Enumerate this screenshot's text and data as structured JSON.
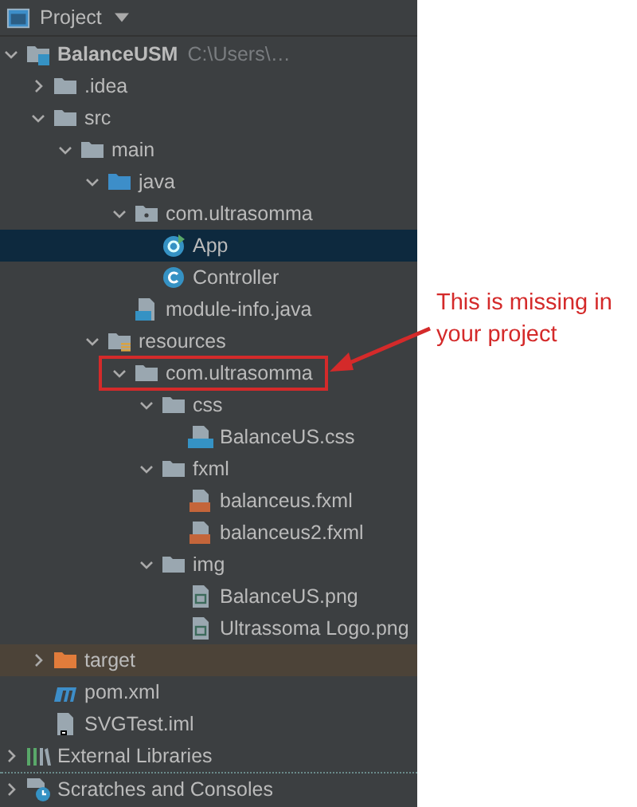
{
  "panel": {
    "title": "Project"
  },
  "tree": [
    {
      "label": "BalanceUSM",
      "path": "C:\\Users\\…",
      "kind": "module",
      "expanded": true,
      "selected": false,
      "children": [
        {
          "label": ".idea",
          "kind": "folder",
          "expanded": false,
          "selected": false
        },
        {
          "label": "src",
          "kind": "folder",
          "expanded": true,
          "selected": false,
          "children": [
            {
              "label": "main",
              "kind": "folder",
              "expanded": true,
              "selected": false,
              "children": [
                {
                  "label": "java",
                  "kind": "source-folder",
                  "expanded": true,
                  "selected": false,
                  "children": [
                    {
                      "label": "com.ultrasomma",
                      "kind": "package",
                      "expanded": true,
                      "selected": false,
                      "children": [
                        {
                          "label": "App",
                          "kind": "app-class",
                          "selected": true
                        },
                        {
                          "label": "Controller",
                          "kind": "class",
                          "selected": false
                        }
                      ]
                    },
                    {
                      "label": "module-info.java",
                      "kind": "java-file",
                      "selected": false
                    }
                  ]
                },
                {
                  "label": "resources",
                  "kind": "resources-folder",
                  "expanded": true,
                  "selected": false,
                  "children": [
                    {
                      "label": "com.ultrasomma",
                      "kind": "folder",
                      "expanded": true,
                      "selected": false,
                      "callout": true,
                      "children": [
                        {
                          "label": "css",
                          "kind": "folder",
                          "expanded": true,
                          "selected": false,
                          "children": [
                            {
                              "label": "BalanceUS.css",
                              "kind": "css-file",
                              "selected": false
                            }
                          ]
                        },
                        {
                          "label": "fxml",
                          "kind": "folder",
                          "expanded": true,
                          "selected": false,
                          "children": [
                            {
                              "label": "balanceus.fxml",
                              "kind": "fxml-file",
                              "selected": false
                            },
                            {
                              "label": "balanceus2.fxml",
                              "kind": "fxml-file",
                              "selected": false
                            }
                          ]
                        },
                        {
                          "label": "img",
                          "kind": "folder",
                          "expanded": true,
                          "selected": false,
                          "children": [
                            {
                              "label": "BalanceUS.png",
                              "kind": "image-file",
                              "selected": false
                            },
                            {
                              "label": "Ultrassoma Logo.png",
                              "kind": "image-file",
                              "selected": false
                            }
                          ]
                        }
                      ]
                    }
                  ]
                }
              ]
            }
          ]
        },
        {
          "label": "target",
          "kind": "excluded-folder",
          "expanded": false,
          "selected": false
        },
        {
          "label": "pom.xml",
          "kind": "maven-file",
          "selected": false
        },
        {
          "label": "SVGTest.iml",
          "kind": "iml-file",
          "selected": false
        }
      ]
    },
    {
      "label": "External Libraries",
      "kind": "libraries",
      "expanded": false,
      "selected": false
    },
    {
      "label": "Scratches and Consoles",
      "kind": "scratches",
      "expanded": false,
      "selected": false
    }
  ],
  "annotation": {
    "text": "This is missing in your project"
  }
}
